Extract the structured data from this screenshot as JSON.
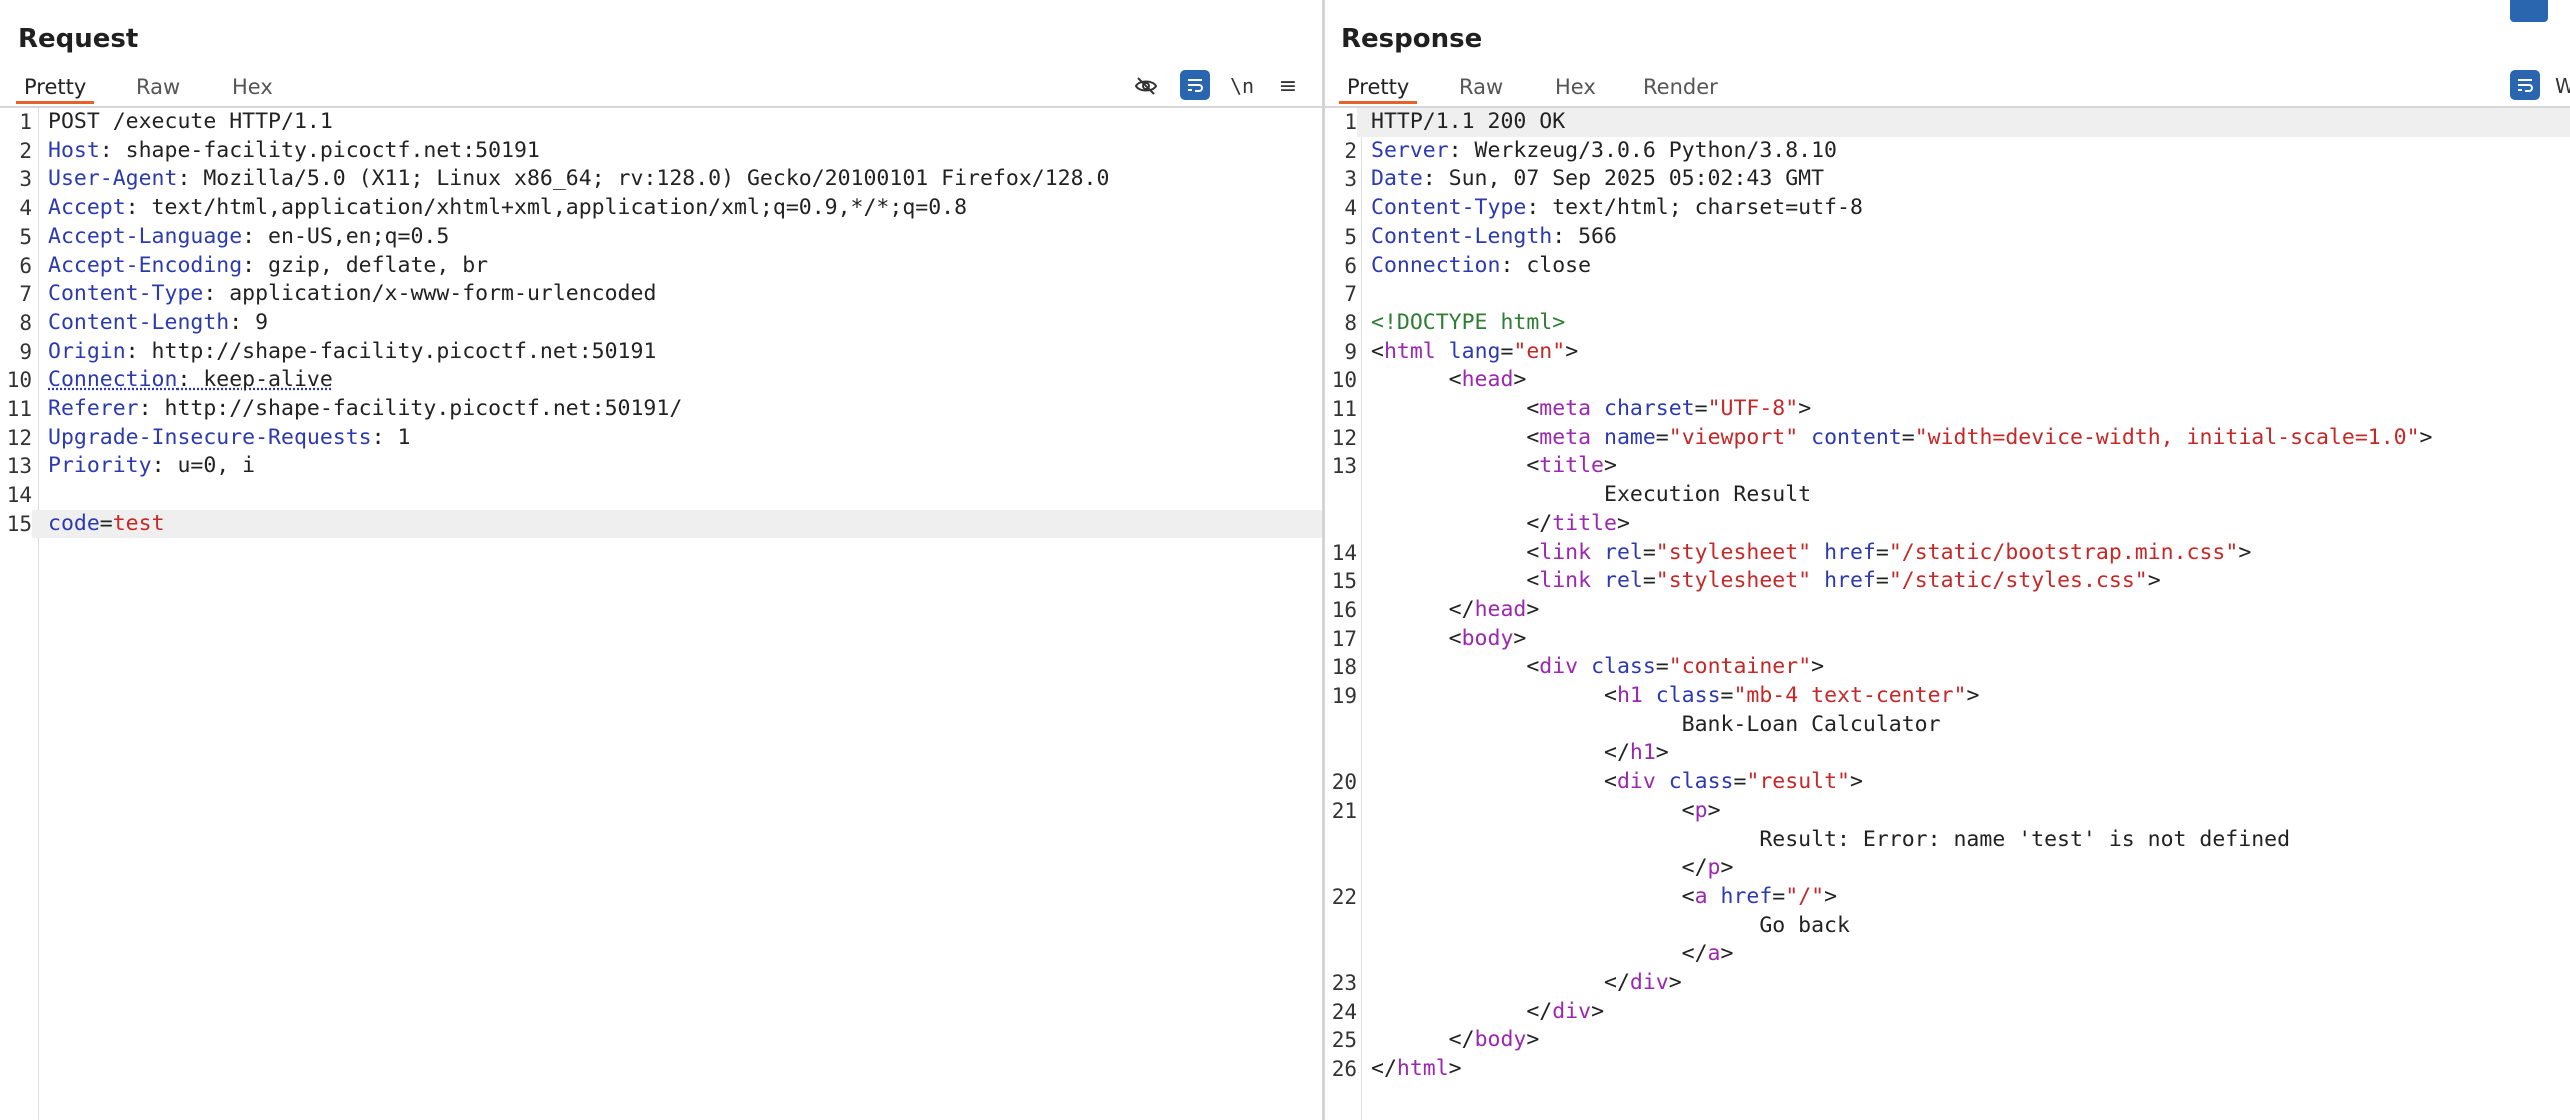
{
  "request": {
    "title": "Request",
    "tabs": [
      "Pretty",
      "Raw",
      "Hex"
    ],
    "lines": [
      {
        "n": "1",
        "parts": [
          [
            "v",
            "POST /execute HTTP/1.1"
          ]
        ]
      },
      {
        "n": "2",
        "parts": [
          [
            "k",
            "Host"
          ],
          [
            "v",
            ": shape-facility.picoctf.net:50191"
          ]
        ]
      },
      {
        "n": "3",
        "parts": [
          [
            "k",
            "User-Agent"
          ],
          [
            "v",
            ": Mozilla/5.0 (X11; Linux x86_64; rv:128.0) Gecko/20100101 Firefox/128.0"
          ]
        ]
      },
      {
        "n": "4",
        "parts": [
          [
            "k",
            "Accept"
          ],
          [
            "v",
            ": text/html,application/xhtml+xml,application/xml;q=0.9,*/*;q=0.8"
          ]
        ]
      },
      {
        "n": "5",
        "parts": [
          [
            "k",
            "Accept-Language"
          ],
          [
            "v",
            ": en-US,en;q=0.5"
          ]
        ]
      },
      {
        "n": "6",
        "parts": [
          [
            "k",
            "Accept-Encoding"
          ],
          [
            "v",
            ": gzip, deflate, br"
          ]
        ]
      },
      {
        "n": "7",
        "parts": [
          [
            "k",
            "Content-Type"
          ],
          [
            "v",
            ": application/x-www-form-urlencoded"
          ]
        ]
      },
      {
        "n": "8",
        "parts": [
          [
            "k",
            "Content-Length"
          ],
          [
            "v",
            ": 9"
          ]
        ]
      },
      {
        "n": "9",
        "parts": [
          [
            "k",
            "Origin"
          ],
          [
            "v",
            ": http://shape-facility.picoctf.net:50191"
          ]
        ]
      },
      {
        "n": "10",
        "parts": [
          [
            "kd",
            "Connection"
          ],
          [
            "vd",
            ": keep-alive"
          ]
        ]
      },
      {
        "n": "11",
        "parts": [
          [
            "k",
            "Referer"
          ],
          [
            "v",
            ": http://shape-facility.picoctf.net:50191/"
          ]
        ]
      },
      {
        "n": "12",
        "parts": [
          [
            "k",
            "Upgrade-Insecure-Requests"
          ],
          [
            "v",
            ": 1"
          ]
        ]
      },
      {
        "n": "13",
        "parts": [
          [
            "k",
            "Priority"
          ],
          [
            "v",
            ": u=0, i"
          ]
        ]
      },
      {
        "n": "14",
        "parts": []
      },
      {
        "n": "15",
        "parts": [
          [
            "a",
            "code"
          ],
          [
            "v",
            "="
          ],
          [
            "s",
            "test"
          ]
        ],
        "hl": true
      }
    ]
  },
  "response": {
    "title": "Response",
    "tabs": [
      "Pretty",
      "Raw",
      "Hex",
      "Render"
    ],
    "lines": [
      {
        "n": "1",
        "parts": [
          [
            "v",
            "HTTP/1.1 200 OK"
          ]
        ],
        "hl": true
      },
      {
        "n": "2",
        "parts": [
          [
            "k",
            "Server"
          ],
          [
            "v",
            ": Werkzeug/3.0.6 Python/3.8.10"
          ]
        ]
      },
      {
        "n": "3",
        "parts": [
          [
            "k",
            "Date"
          ],
          [
            "v",
            ": Sun, 07 Sep 2025 05:02:43 GMT"
          ]
        ]
      },
      {
        "n": "4",
        "parts": [
          [
            "k",
            "Content-Type"
          ],
          [
            "v",
            ": text/html; charset=utf-8"
          ]
        ]
      },
      {
        "n": "5",
        "parts": [
          [
            "k",
            "Content-Length"
          ],
          [
            "v",
            ": 566"
          ]
        ]
      },
      {
        "n": "6",
        "parts": [
          [
            "k",
            "Connection"
          ],
          [
            "v",
            ": close"
          ]
        ]
      },
      {
        "n": "7",
        "parts": []
      },
      {
        "n": "8",
        "parts": [
          [
            "d",
            "<!DOCTYPE html>"
          ]
        ]
      },
      {
        "n": "9",
        "parts": [
          [
            "v",
            "<"
          ],
          [
            "t",
            "html"
          ],
          [
            "a",
            " lang"
          ],
          [
            "v",
            "="
          ],
          [
            "s",
            "\"en\""
          ],
          [
            "v",
            ">"
          ]
        ]
      },
      {
        "n": "10",
        "parts": [
          [
            "v",
            "      <"
          ],
          [
            "t",
            "head"
          ],
          [
            "v",
            ">"
          ]
        ]
      },
      {
        "n": "11",
        "parts": [
          [
            "v",
            "            <"
          ],
          [
            "t",
            "meta"
          ],
          [
            "a",
            " charset"
          ],
          [
            "v",
            "="
          ],
          [
            "s",
            "\"UTF-8\""
          ],
          [
            "v",
            ">"
          ]
        ]
      },
      {
        "n": "12",
        "parts": [
          [
            "v",
            "            <"
          ],
          [
            "t",
            "meta"
          ],
          [
            "a",
            " name"
          ],
          [
            "v",
            "="
          ],
          [
            "s",
            "\"viewport\""
          ],
          [
            "a",
            " content"
          ],
          [
            "v",
            "="
          ],
          [
            "s",
            "\"width=device-width, initial-scale=1.0\""
          ],
          [
            "v",
            ">"
          ]
        ]
      },
      {
        "n": "13",
        "parts": [
          [
            "v",
            "            <"
          ],
          [
            "t",
            "title"
          ],
          [
            "v",
            ">"
          ]
        ]
      },
      {
        "n": "",
        "parts": [
          [
            "v",
            "                  Execution Result"
          ]
        ]
      },
      {
        "n": "",
        "parts": [
          [
            "v",
            "            </"
          ],
          [
            "t",
            "title"
          ],
          [
            "v",
            ">"
          ]
        ]
      },
      {
        "n": "14",
        "parts": [
          [
            "v",
            "            <"
          ],
          [
            "t",
            "link"
          ],
          [
            "a",
            " rel"
          ],
          [
            "v",
            "="
          ],
          [
            "s",
            "\"stylesheet\""
          ],
          [
            "a",
            " href"
          ],
          [
            "v",
            "="
          ],
          [
            "s",
            "\"/static/bootstrap.min.css\""
          ],
          [
            "v",
            ">"
          ]
        ]
      },
      {
        "n": "15",
        "parts": [
          [
            "v",
            "            <"
          ],
          [
            "t",
            "link"
          ],
          [
            "a",
            " rel"
          ],
          [
            "v",
            "="
          ],
          [
            "s",
            "\"stylesheet\""
          ],
          [
            "a",
            " href"
          ],
          [
            "v",
            "="
          ],
          [
            "s",
            "\"/static/styles.css\""
          ],
          [
            "v",
            ">"
          ]
        ]
      },
      {
        "n": "16",
        "parts": [
          [
            "v",
            "      </"
          ],
          [
            "t",
            "head"
          ],
          [
            "v",
            ">"
          ]
        ]
      },
      {
        "n": "17",
        "parts": [
          [
            "v",
            "      <"
          ],
          [
            "t",
            "body"
          ],
          [
            "v",
            ">"
          ]
        ]
      },
      {
        "n": "18",
        "parts": [
          [
            "v",
            "            <"
          ],
          [
            "t",
            "div"
          ],
          [
            "a",
            " class"
          ],
          [
            "v",
            "="
          ],
          [
            "s",
            "\"container\""
          ],
          [
            "v",
            ">"
          ]
        ]
      },
      {
        "n": "19",
        "parts": [
          [
            "v",
            "                  <"
          ],
          [
            "t",
            "h1"
          ],
          [
            "a",
            " class"
          ],
          [
            "v",
            "="
          ],
          [
            "s",
            "\"mb-4 text-center\""
          ],
          [
            "v",
            ">"
          ]
        ]
      },
      {
        "n": "",
        "parts": [
          [
            "v",
            "                        Bank-Loan Calculator"
          ]
        ]
      },
      {
        "n": "",
        "parts": [
          [
            "v",
            "                  </"
          ],
          [
            "t",
            "h1"
          ],
          [
            "v",
            ">"
          ]
        ]
      },
      {
        "n": "20",
        "parts": [
          [
            "v",
            "                  <"
          ],
          [
            "t",
            "div"
          ],
          [
            "a",
            " class"
          ],
          [
            "v",
            "="
          ],
          [
            "s",
            "\"result\""
          ],
          [
            "v",
            ">"
          ]
        ]
      },
      {
        "n": "21",
        "parts": [
          [
            "v",
            "                        <"
          ],
          [
            "t",
            "p"
          ],
          [
            "v",
            ">"
          ]
        ]
      },
      {
        "n": "",
        "parts": [
          [
            "v",
            "                              Result: Error: name 'test' is not defined"
          ]
        ]
      },
      {
        "n": "",
        "parts": [
          [
            "v",
            "                        </"
          ],
          [
            "t",
            "p"
          ],
          [
            "v",
            ">"
          ]
        ]
      },
      {
        "n": "22",
        "parts": [
          [
            "v",
            "                        <"
          ],
          [
            "t",
            "a"
          ],
          [
            "a",
            " href"
          ],
          [
            "v",
            "="
          ],
          [
            "s",
            "\"/\""
          ],
          [
            "v",
            ">"
          ]
        ]
      },
      {
        "n": "",
        "parts": [
          [
            "v",
            "                              Go back"
          ]
        ]
      },
      {
        "n": "",
        "parts": [
          [
            "v",
            "                        </"
          ],
          [
            "t",
            "a"
          ],
          [
            "v",
            ">"
          ]
        ]
      },
      {
        "n": "23",
        "parts": [
          [
            "v",
            "                  </"
          ],
          [
            "t",
            "div"
          ],
          [
            "v",
            ">"
          ]
        ]
      },
      {
        "n": "24",
        "parts": [
          [
            "v",
            "            </"
          ],
          [
            "t",
            "div"
          ],
          [
            "v",
            ">"
          ]
        ]
      },
      {
        "n": "25",
        "parts": [
          [
            "v",
            "      </"
          ],
          [
            "t",
            "body"
          ],
          [
            "v",
            ">"
          ]
        ]
      },
      {
        "n": "26",
        "parts": [
          [
            "v",
            "</"
          ],
          [
            "t",
            "html"
          ],
          [
            "v",
            ">"
          ]
        ]
      }
    ]
  },
  "icons": {
    "hide": "eye-slash-icon",
    "wrap": "word-wrap-icon",
    "newline": "\\n",
    "menu": "≡",
    "resp_wrap": "word-wrap-icon",
    "resp_clipped_label": "W"
  },
  "colors": {
    "accent": "#e8602c",
    "toolbar_blue": "#2a66b0"
  }
}
